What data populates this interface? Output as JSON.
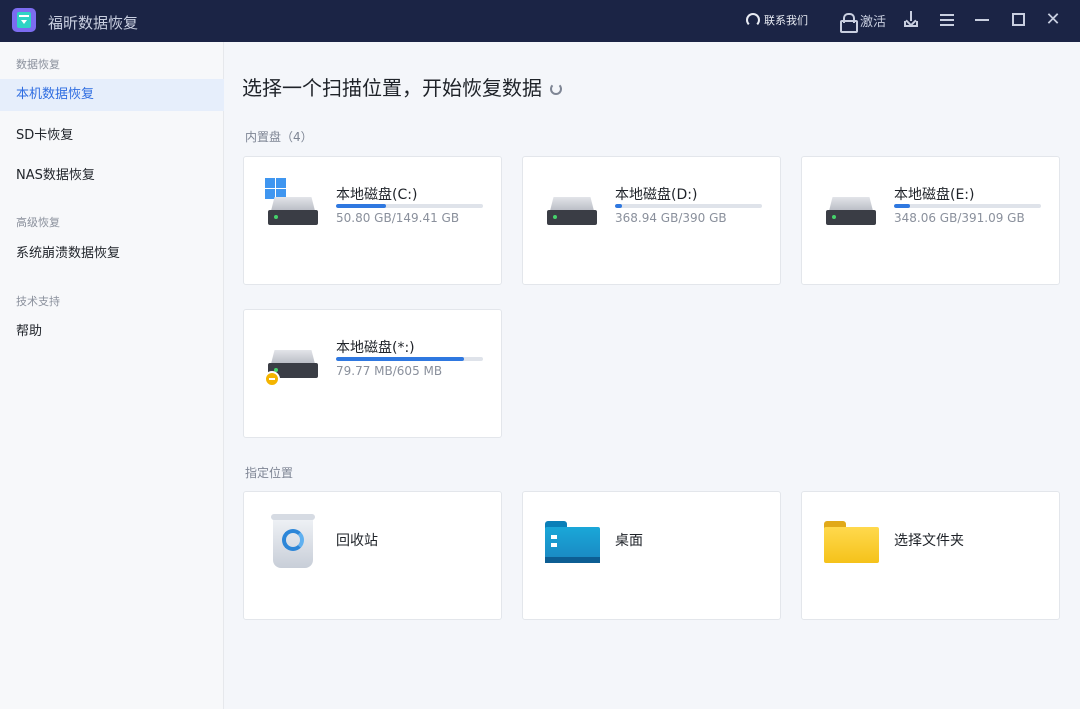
{
  "app": {
    "title": "福昕数据恢复"
  },
  "titlebar": {
    "contact_label": "联系我们",
    "activate_label": "激活"
  },
  "sidebar": {
    "groups": [
      {
        "label": "数据恢复",
        "items": [
          {
            "label": "本机数据恢复",
            "active": true
          },
          {
            "label": "SD卡恢复"
          },
          {
            "label": "NAS数据恢复"
          }
        ]
      },
      {
        "label": "高级恢复",
        "items": [
          {
            "label": "系统崩溃数据恢复"
          }
        ]
      },
      {
        "label": "技术支持",
        "items": [
          {
            "label": "帮助"
          }
        ]
      }
    ]
  },
  "main": {
    "title": "选择一个扫描位置，开始恢复数据",
    "internal_disks": {
      "label": "内置盘（4）",
      "disks": [
        {
          "name": "本地磁盘(C:)",
          "size": "50.80 GB/149.41 GB",
          "usage_fraction": 0.34,
          "system": true
        },
        {
          "name": "本地磁盘(D:)",
          "size": "368.94 GB/390 GB",
          "usage_fraction": 0.05
        },
        {
          "name": "本地磁盘(E:)",
          "size": "348.06 GB/391.09 GB",
          "usage_fraction": 0.11
        },
        {
          "name": "本地磁盘(*:)",
          "size": "79.77 MB/605 MB",
          "usage_fraction": 0.87,
          "warning": true
        }
      ]
    },
    "locations": {
      "label": "指定位置",
      "items": [
        {
          "name": "回收站",
          "icon": "recycle-bin-icon"
        },
        {
          "name": "桌面",
          "icon": "desktop-folder-icon"
        },
        {
          "name": "选择文件夹",
          "icon": "folder-icon"
        }
      ]
    }
  },
  "colors": {
    "titlebar_bg": "#1b2445",
    "accent": "#2f78e0",
    "active_bg": "#e6eefb"
  }
}
